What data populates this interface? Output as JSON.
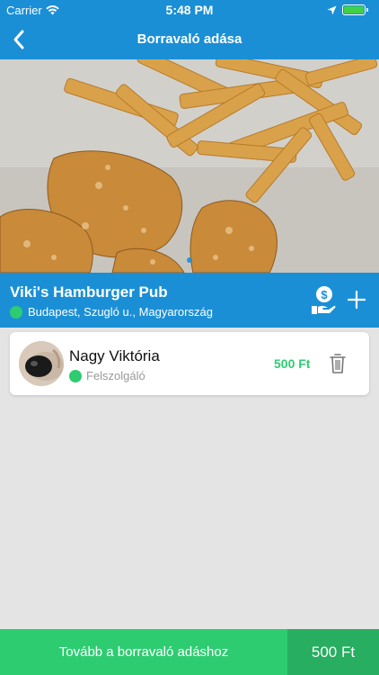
{
  "status_bar": {
    "carrier": "Carrier",
    "time": "5:48 PM",
    "battery_level": 1.0
  },
  "nav": {
    "title": "Borravaló adása"
  },
  "photo": {
    "page_count": 1,
    "current_page": 1
  },
  "venue": {
    "name": "Viki's Hamburger Pub",
    "address": "Budapest, Szugló u., Magyarország"
  },
  "staff": [
    {
      "name": "Nagy Viktória",
      "role": "Felszolgáló",
      "amount": "500 Ft"
    }
  ],
  "bottom": {
    "continue_label": "Tovább a borravaló adáshoz",
    "total": "500 Ft"
  },
  "colors": {
    "primary_blue": "#1a8fd6",
    "accent_green": "#2ecc71",
    "dark_green": "#27ae60",
    "background": "#e4e4e4"
  },
  "icons": [
    "back-chevron-icon",
    "wifi-icon",
    "location-arrow-icon",
    "battery-icon",
    "money-hand-icon",
    "plus-icon",
    "trash-icon"
  ]
}
